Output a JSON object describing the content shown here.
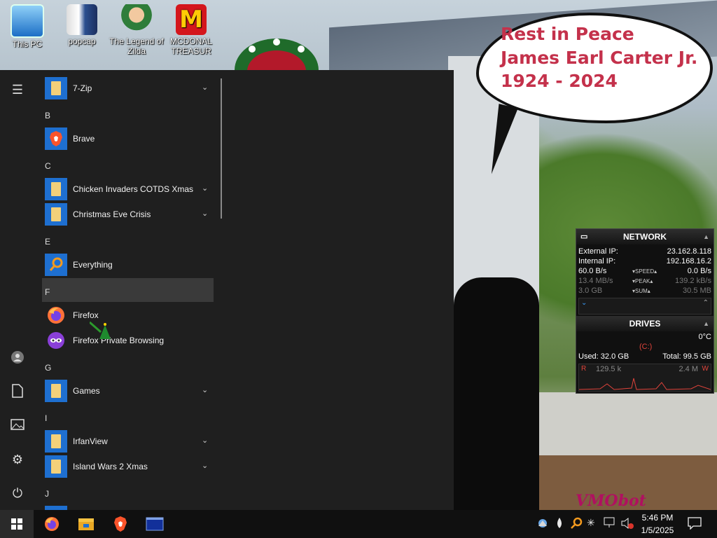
{
  "desktop_icons": [
    {
      "label": "This PC",
      "icon": "this-pc-icon"
    },
    {
      "label": "popcap",
      "icon": "popcap-icon"
    },
    {
      "label": "The Legend of Zilda",
      "icon": "legend-of-zilda-icon"
    },
    {
      "label": "MCDONAL TREASUR",
      "icon": "mcdonald-icon"
    }
  ],
  "bubble": {
    "line1": "Rest in Peace",
    "line2": "James Earl Carter Jr.",
    "line3": "1924 - 2024"
  },
  "signature": "VMObot",
  "start_menu": {
    "letters": [
      "B",
      "C",
      "E",
      "F",
      "G",
      "I",
      "J"
    ],
    "items": [
      {
        "label": "7-Zip",
        "type": "folder",
        "expand": true
      },
      {
        "label": "Brave",
        "type": "app",
        "icon": "brave-icon",
        "expand": false
      },
      {
        "label": "Chicken Invaders COTDS Xmas",
        "type": "folder",
        "expand": true
      },
      {
        "label": "Christmas Eve Crisis",
        "type": "folder",
        "expand": true
      },
      {
        "label": "Everything",
        "type": "app",
        "icon": "everything-search-icon",
        "expand": false
      },
      {
        "label": "Firefox",
        "type": "app",
        "icon": "firefox-icon",
        "expand": false
      },
      {
        "label": "Firefox Private Browsing",
        "type": "app",
        "icon": "firefox-private-icon",
        "expand": false
      },
      {
        "label": "Games",
        "type": "folder",
        "expand": true
      },
      {
        "label": "IrfanView",
        "type": "folder",
        "expand": true
      },
      {
        "label": "Island Wars 2 Xmas",
        "type": "folder",
        "expand": true
      }
    ],
    "expand_glyph": "⌄"
  },
  "rail_icons": [
    "hamburger-icon",
    "user-icon",
    "documents-icon",
    "pictures-icon",
    "settings-icon",
    "power-icon"
  ],
  "network": {
    "title": "NETWORK",
    "external_ip_label": "External IP:",
    "external_ip": "23.162.8.118",
    "internal_ip_label": "Internal IP:",
    "internal_ip": "192.168.16.2",
    "speed_left": "60.0 B/s",
    "speed_label": "SPEED",
    "speed_right": "0.0 B/s",
    "peak_left": "13.4 MB/s",
    "peak_label": "PEAK",
    "peak_right": "139.2 kB/s",
    "sum_left": "3.0 GB",
    "sum_label": "SUM",
    "sum_right": "30.5 MB"
  },
  "drives": {
    "title": "DRIVES",
    "temp": "0°C",
    "drive": "(C:)",
    "used": "Used: 32.0 GB",
    "total": "Total: 99.5 GB",
    "read": "129.5 k",
    "write": "2.4 M"
  },
  "taskbar": {
    "apps": [
      "firefox-icon",
      "file-explorer-icon",
      "brave-icon",
      "window-app-icon"
    ],
    "time": "5:46 PM",
    "date": "1/5/2025"
  },
  "colors": {
    "bubble_text": "#c4314b",
    "folder_tile": "#1e6fd0",
    "menu_bg": "#1f1f1f"
  }
}
